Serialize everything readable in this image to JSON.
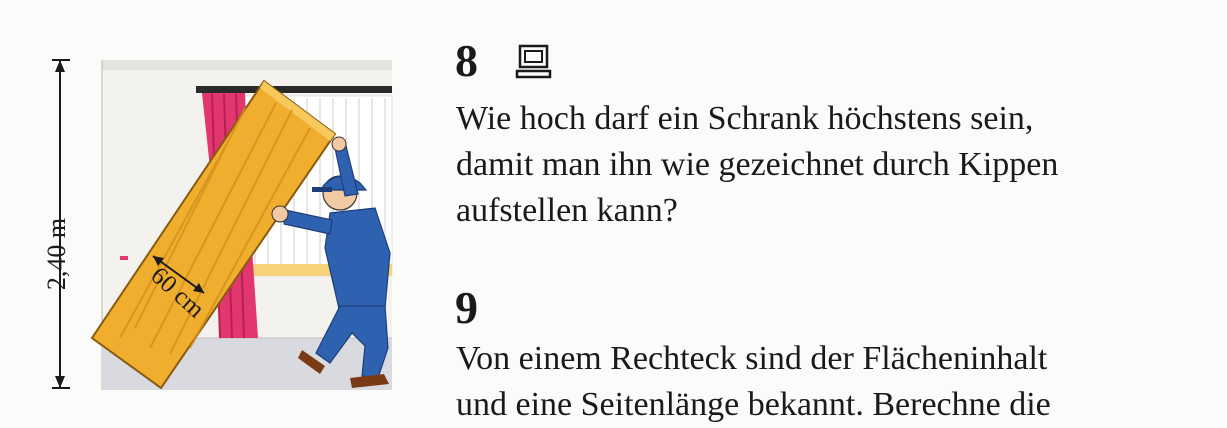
{
  "figure": {
    "height_label": "2,40 m",
    "width_label": "60 cm"
  },
  "exercise8": {
    "number": "8",
    "icon": "computer-icon",
    "lines": [
      "Wie hoch darf ein Schrank höchstens sein,",
      "damit man ihn wie gezeichnet durch Kippen",
      "aufstellen kann?"
    ]
  },
  "exercise9": {
    "number": "9",
    "lines": [
      "Von einem Rechteck sind der Flächeninhalt",
      "und eine Seitenlänge bekannt. Berechne die"
    ]
  },
  "colors": {
    "cabinet": "#f0ae2e",
    "curtain": "#e2366e",
    "uniform": "#2e61b0",
    "floor": "#d9dadf",
    "wall": "#f3f2ee"
  }
}
